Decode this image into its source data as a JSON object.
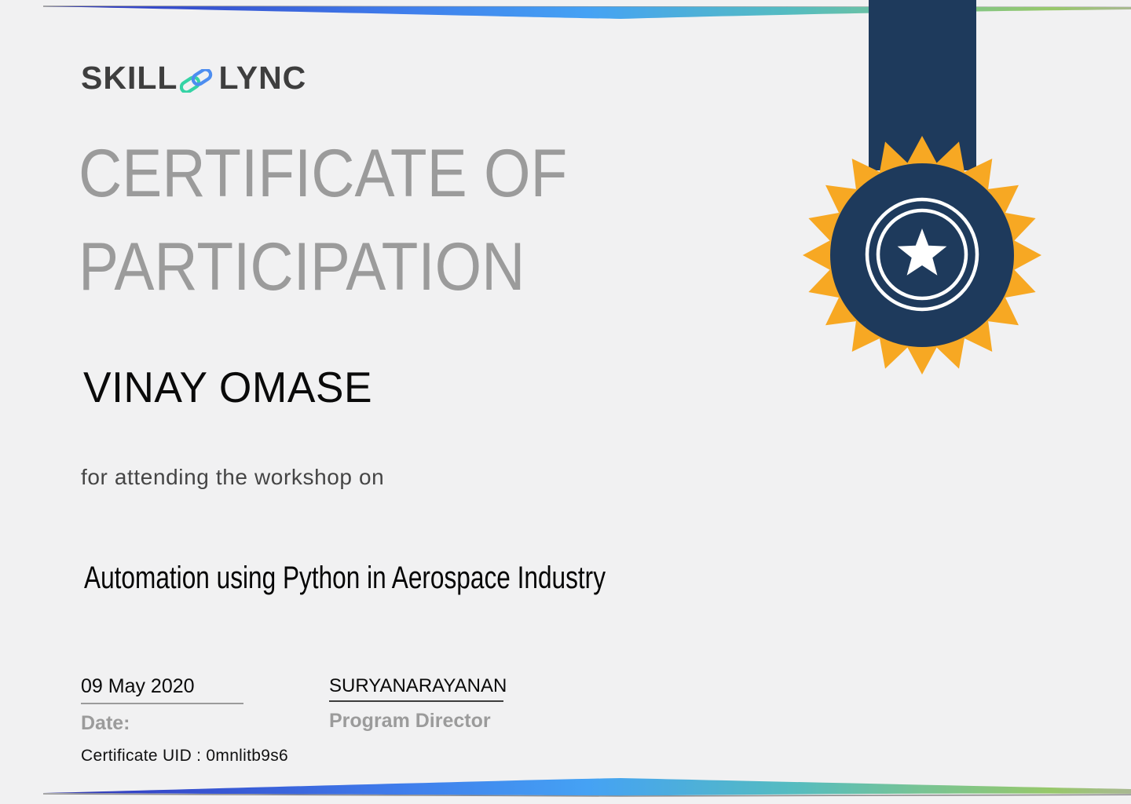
{
  "certificate": {
    "brand": {
      "name_left": "SKILL",
      "name_right": "LYNC",
      "link_icon": "chain-link-icon",
      "link_icon_colors": {
        "left_link": "#35d3a5",
        "right_link": "#4d8df0"
      }
    },
    "title_line1": "CERTIFICATE OF",
    "title_line2": "PARTICIPATION",
    "recipient_name": "VINAY OMASE",
    "subtitle": "for attending the workshop on",
    "course_title": "Automation using Python in Aerospace Industry",
    "signature_row": {
      "date_value": "09 May 2020",
      "date_label": "Date:",
      "signatory_name": "SURYANARAYANAN",
      "signatory_title": "Program Director"
    },
    "uid_line": "Certificate UID : 0mnlitb9s6",
    "medal": {
      "icon": "award-medal-ribbon-icon",
      "ribbon_color": "#1e3a5c",
      "burst_color": "#f7a823",
      "star_color": "#ffffff"
    },
    "colors": {
      "background": "#f1f1f2",
      "heading_gray": "#9b9b9b",
      "text_black": "#0a0a0a",
      "band_gradient": [
        "#312e92",
        "#3445c8",
        "#3f7ceb",
        "#45a2f4",
        "#55bcc0",
        "#79c492",
        "#97c86a",
        "#a9b892"
      ]
    }
  }
}
